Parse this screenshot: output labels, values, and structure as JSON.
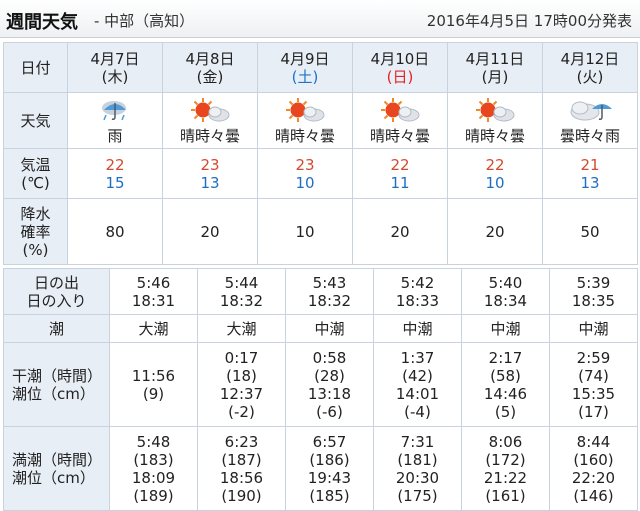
{
  "header": {
    "title": "週間天気",
    "region": "- 中部（高知）",
    "issued": "2016年4月5日 17時00分発表"
  },
  "weather": {
    "labels": {
      "date": "日付",
      "weather": "天気",
      "temp": [
        "気温",
        "(℃)"
      ],
      "precip": [
        "降水",
        "確率",
        "(%)"
      ]
    },
    "days": [
      {
        "date": "4月7日",
        "dow": "(木)",
        "dow_type": "weekday",
        "icon": "umbrella-icon",
        "desc": "雨",
        "max": "22",
        "min": "15",
        "pop": "80"
      },
      {
        "date": "4月8日",
        "dow": "(金)",
        "dow_type": "weekday",
        "icon": "sun-cloud-icon",
        "desc": "晴時々曇",
        "max": "23",
        "min": "13",
        "pop": "20"
      },
      {
        "date": "4月9日",
        "dow": "(土)",
        "dow_type": "saturday",
        "icon": "sun-cloud-icon",
        "desc": "晴時々曇",
        "max": "23",
        "min": "10",
        "pop": "10"
      },
      {
        "date": "4月10日",
        "dow": "(日)",
        "dow_type": "sunday",
        "icon": "sun-cloud-icon",
        "desc": "晴時々曇",
        "max": "22",
        "min": "11",
        "pop": "20"
      },
      {
        "date": "4月11日",
        "dow": "(月)",
        "dow_type": "weekday",
        "icon": "sun-cloud-icon",
        "desc": "晴時々曇",
        "max": "22",
        "min": "10",
        "pop": "20"
      },
      {
        "date": "4月12日",
        "dow": "(火)",
        "dow_type": "weekday",
        "icon": "cloud-umbrella-icon",
        "desc": "曇時々雨",
        "max": "21",
        "min": "13",
        "pop": "50"
      }
    ],
    "colors": {
      "max": "#d24b2e",
      "min": "#1e6fc2",
      "saturday": "#1d74c9",
      "sunday": "#e0252b",
      "header_bg": "#e8eef5",
      "border": "#c8d3df"
    }
  },
  "tide": {
    "labels": {
      "sun": [
        "日の出",
        "日の入り"
      ],
      "tide": "潮",
      "low": [
        "干潮（時間）",
        "潮位（cm）"
      ],
      "high": [
        "満潮（時間）",
        "潮位（cm）"
      ]
    },
    "days": [
      {
        "sunrise": "5:46",
        "sunset": "18:31",
        "tide": "大潮",
        "low": [
          "11:56",
          "(9)"
        ],
        "high": [
          "5:48",
          "(183)",
          "18:09",
          "(189)"
        ]
      },
      {
        "sunrise": "5:44",
        "sunset": "18:32",
        "tide": "大潮",
        "low": [
          "0:17",
          "(18)",
          "12:37",
          "(-2)"
        ],
        "high": [
          "6:23",
          "(187)",
          "18:56",
          "(190)"
        ]
      },
      {
        "sunrise": "5:43",
        "sunset": "18:32",
        "tide": "中潮",
        "low": [
          "0:58",
          "(28)",
          "13:18",
          "(-6)"
        ],
        "high": [
          "6:57",
          "(186)",
          "19:43",
          "(185)"
        ]
      },
      {
        "sunrise": "5:42",
        "sunset": "18:33",
        "tide": "中潮",
        "low": [
          "1:37",
          "(42)",
          "14:01",
          "(-4)"
        ],
        "high": [
          "7:31",
          "(181)",
          "20:30",
          "(175)"
        ]
      },
      {
        "sunrise": "5:40",
        "sunset": "18:34",
        "tide": "中潮",
        "low": [
          "2:17",
          "(58)",
          "14:46",
          "(5)"
        ],
        "high": [
          "8:06",
          "(172)",
          "21:22",
          "(161)"
        ]
      },
      {
        "sunrise": "5:39",
        "sunset": "18:35",
        "tide": "中潮",
        "low": [
          "2:59",
          "(74)",
          "15:35",
          "(17)"
        ],
        "high": [
          "8:44",
          "(160)",
          "22:20",
          "(146)"
        ]
      }
    ]
  }
}
